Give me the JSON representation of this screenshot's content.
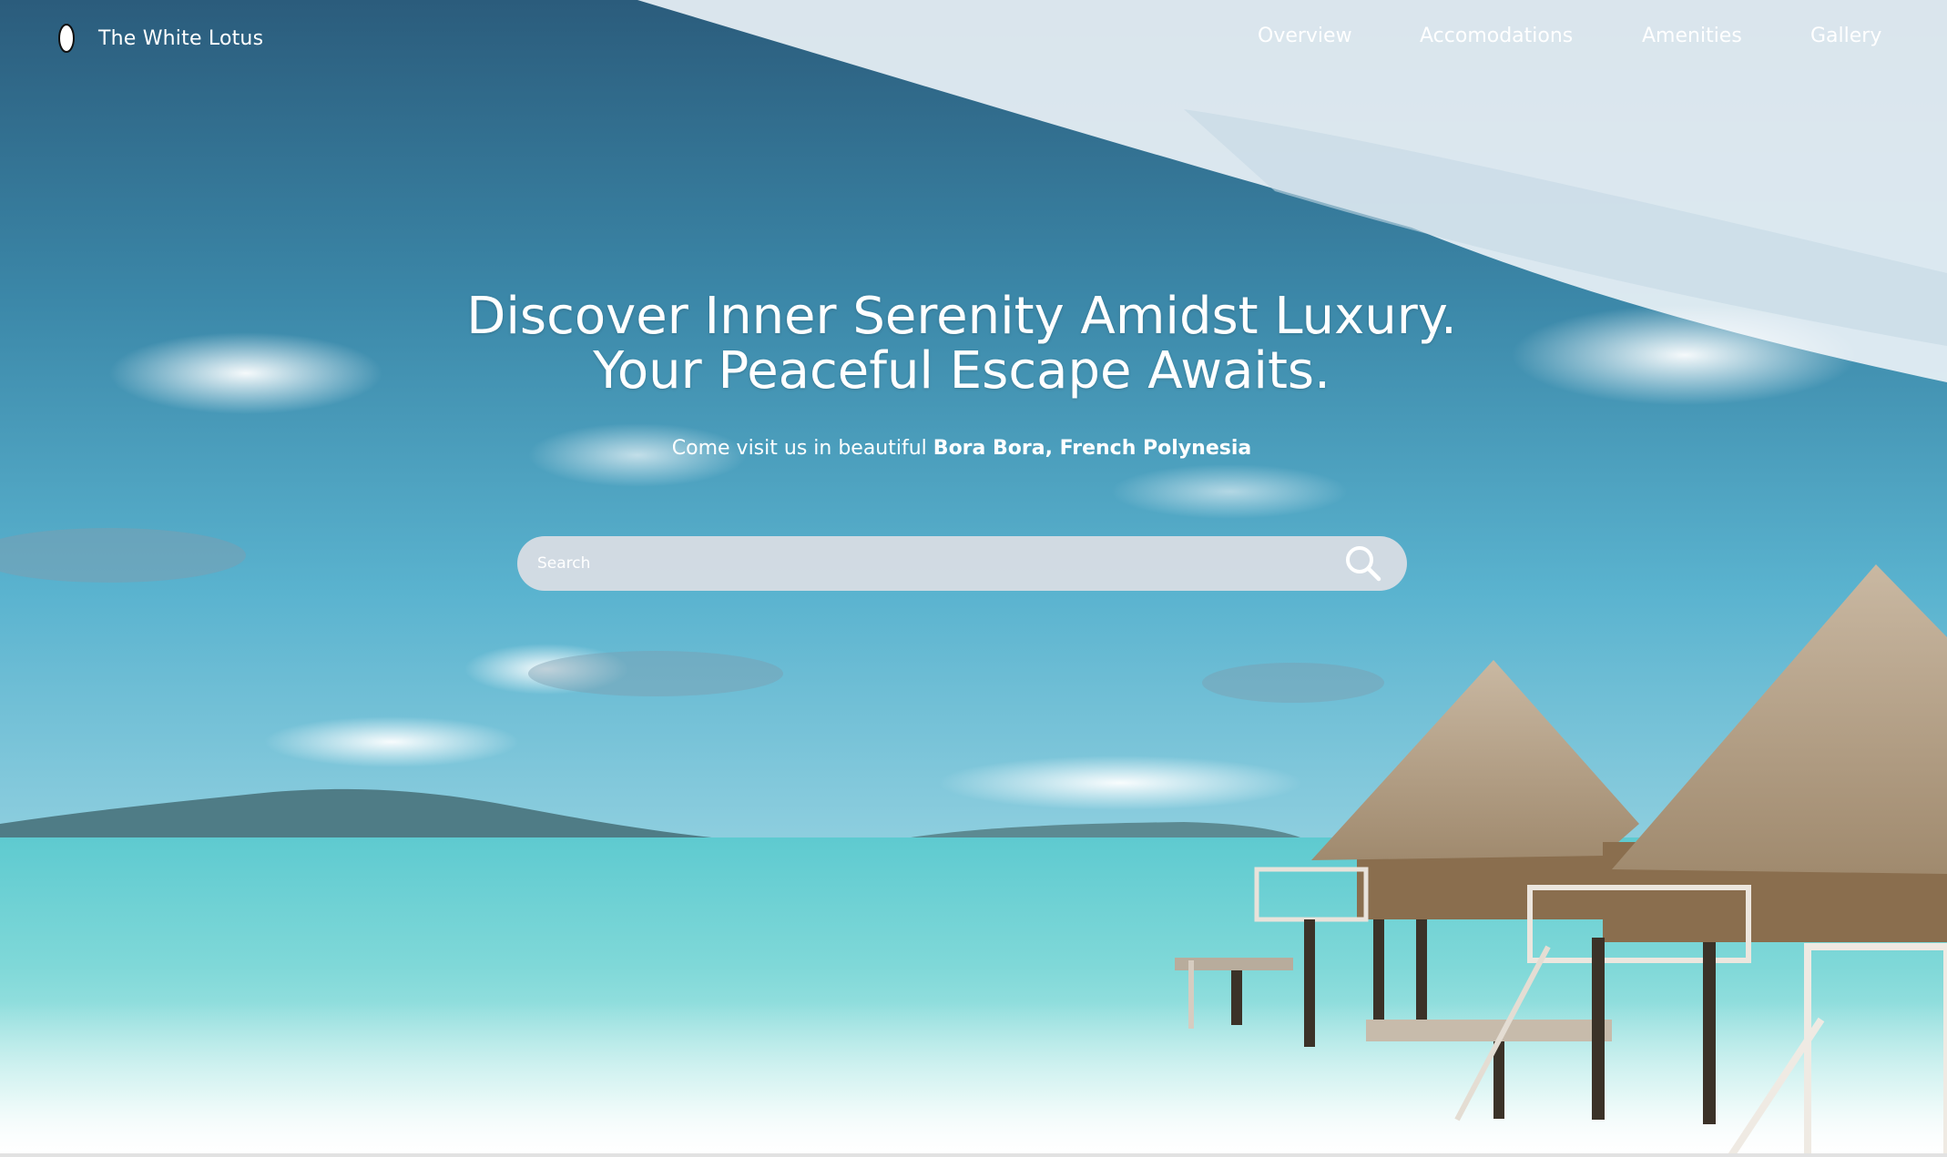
{
  "brand": {
    "name": "The White Lotus",
    "logo_icon": "lotus-seed-icon"
  },
  "nav": {
    "items": [
      {
        "label": "Overview"
      },
      {
        "label": "Accomodations"
      },
      {
        "label": "Amenities"
      },
      {
        "label": "Gallery"
      }
    ]
  },
  "hero": {
    "headline_line1": "Discover Inner Serenity Amidst Luxury.",
    "headline_line2": "Your Peaceful Escape Awaits.",
    "subline_prefix": "Come visit us in beautiful",
    "subline_location": "Bora Bora, French Polynesia",
    "background": "overwater-bungalows-lagoon-photo"
  },
  "search": {
    "placeholder": "Search",
    "value": "",
    "icon": "search-icon"
  },
  "colors": {
    "text": "#ffffff",
    "search_bg": "#dadee4",
    "lagoon": "#6fd0d4",
    "sky": "#3d93b5"
  }
}
